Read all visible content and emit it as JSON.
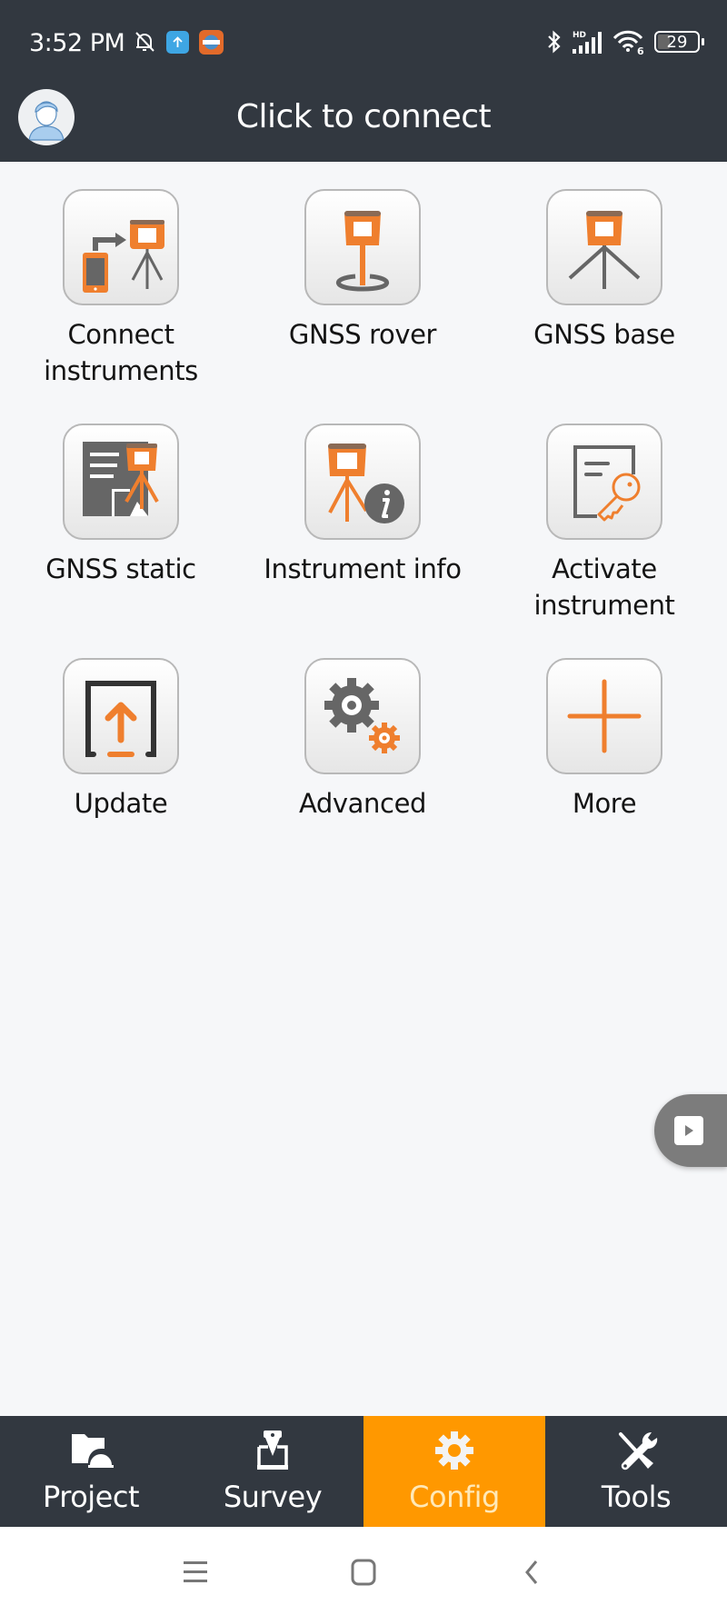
{
  "status_bar": {
    "time": "3:52 PM",
    "icons": [
      "bell-off-icon",
      "upload-app-icon",
      "chcnav-app-icon",
      "bluetooth-icon",
      "hd-signal-icon",
      "wifi-6-icon",
      "battery-icon"
    ],
    "signal_label": "HD",
    "wifi_label": "6",
    "battery_level": "29"
  },
  "header": {
    "title": "Click to connect",
    "avatar_icon": "user-avatar-icon"
  },
  "colors": {
    "bar_bg": "#323840",
    "accent": "#ff9800",
    "icon_orange": "#ef7f2e",
    "icon_gray": "#666666",
    "page_bg": "#f6f7f9"
  },
  "tiles": [
    {
      "label": "Connect\ninstruments",
      "icon": "connect-instruments-icon"
    },
    {
      "label": "GNSS rover",
      "icon": "gnss-rover-icon"
    },
    {
      "label": "GNSS base",
      "icon": "gnss-base-icon"
    },
    {
      "label": "GNSS static",
      "icon": "gnss-static-icon"
    },
    {
      "label": "Instrument info",
      "icon": "instrument-info-icon"
    },
    {
      "label": "Activate\ninstrument",
      "icon": "activate-key-icon"
    },
    {
      "label": "Update",
      "icon": "update-upload-icon"
    },
    {
      "label": "Advanced",
      "icon": "gears-icon"
    },
    {
      "label": "More",
      "icon": "plus-icon"
    }
  ],
  "floating_button": {
    "icon": "play-icon"
  },
  "bottom_nav": {
    "active": "Config",
    "items": [
      {
        "label": "Project",
        "icon": "project-folder-icon"
      },
      {
        "label": "Survey",
        "icon": "survey-icon"
      },
      {
        "label": "Config",
        "icon": "config-gear-icon"
      },
      {
        "label": "Tools",
        "icon": "tools-icon"
      }
    ]
  },
  "system_nav": {
    "buttons": [
      "recents-menu-icon",
      "home-icon",
      "back-icon"
    ]
  }
}
